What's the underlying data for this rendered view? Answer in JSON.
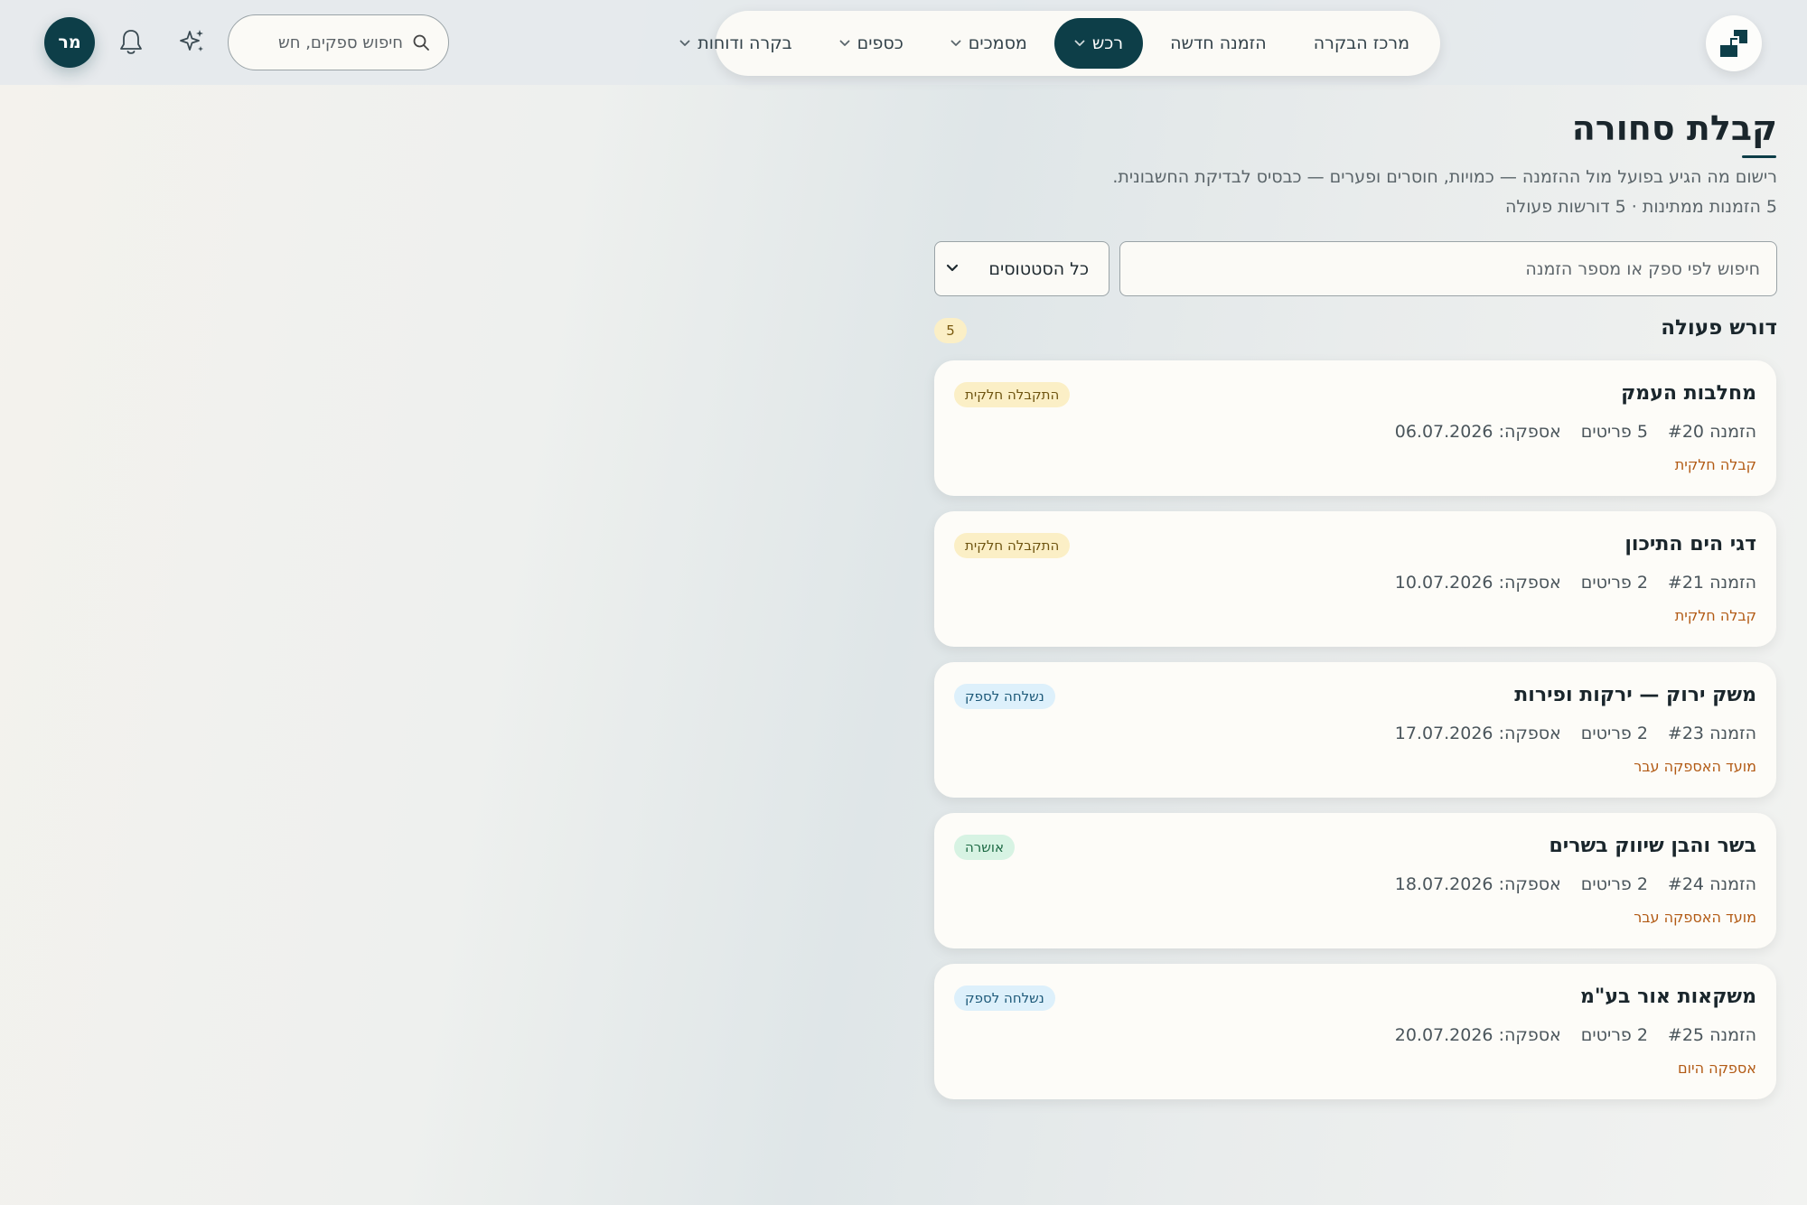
{
  "header": {
    "logo_alt": "logo",
    "nav": [
      {
        "label": "מרכז הבקרה",
        "has_menu": false,
        "active": false
      },
      {
        "label": "הזמנה חדשה",
        "has_menu": false,
        "active": false
      },
      {
        "label": "רכש",
        "has_menu": true,
        "active": true
      },
      {
        "label": "מסמכים",
        "has_menu": true,
        "active": false
      },
      {
        "label": "כספים",
        "has_menu": true,
        "active": false
      },
      {
        "label": "בקרה ודוחות",
        "has_menu": true,
        "active": false
      }
    ],
    "search_placeholder": "חיפוש ספקים, חש",
    "avatar_initials": "מר",
    "icons": {
      "search": "search-icon",
      "sparkle": "sparkle-icon",
      "bell": "bell-icon",
      "chevron": "chevron-down-icon"
    }
  },
  "page": {
    "title": "קבלת סחורה",
    "subtitle": "רישום מה הגיע בפועל מול ההזמנה — כמויות, חוסרים ופערים — כבסיס לבדיקת החשבונית.",
    "stats": "5 הזמנות ממתינות · 5 דורשות פעולה"
  },
  "filters": {
    "search_placeholder": "חיפוש לפי ספק או מספר הזמנה",
    "status_value": "כל הסטטוסים"
  },
  "section": {
    "title": "דורש פעולה",
    "count": "5"
  },
  "orders": [
    {
      "supplier": "מחלבות העמק",
      "order": "הזמנה #20",
      "items": "5 פריטים",
      "delivery": "אספקה: 06.07.2026",
      "note": "קבלה חלקית",
      "badge": "התקבלה חלקית",
      "badge_type": "partial"
    },
    {
      "supplier": "דגי הים התיכון",
      "order": "הזמנה #21",
      "items": "2 פריטים",
      "delivery": "אספקה: 10.07.2026",
      "note": "קבלה חלקית",
      "badge": "התקבלה חלקית",
      "badge_type": "partial"
    },
    {
      "supplier": "משק ירוק — ירקות ופירות",
      "order": "הזמנה #23",
      "items": "2 פריטים",
      "delivery": "אספקה: 17.07.2026",
      "note": "מועד האספקה עבר",
      "badge": "נשלחה לספק",
      "badge_type": "sent"
    },
    {
      "supplier": "בשר והבן שיווק בשרים",
      "order": "הזמנה #24",
      "items": "2 פריטים",
      "delivery": "אספקה: 18.07.2026",
      "note": "מועד האספקה עבר",
      "badge": "אושרה",
      "badge_type": "approved"
    },
    {
      "supplier": "משקאות אור בע\"מ",
      "order": "הזמנה #25",
      "items": "2 פריטים",
      "delivery": "אספקה: 20.07.2026",
      "note": "אספקה היום",
      "badge": "נשלחה לספק",
      "badge_type": "sent"
    }
  ],
  "colors": {
    "primary": "#0d3e48",
    "note": "#b25a14",
    "badge_partial_bg": "#fbefc6",
    "badge_sent_bg": "#ddf0fb",
    "badge_approved_bg": "#d7f3e3"
  }
}
